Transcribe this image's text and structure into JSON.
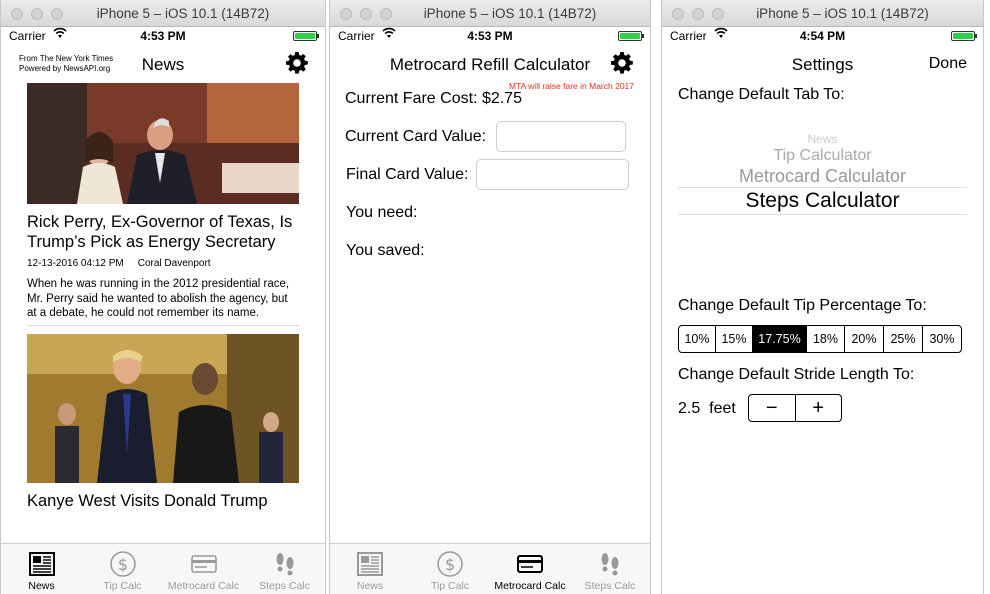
{
  "window_title": "iPhone 5 – iOS 10.1 (14B72)",
  "status": {
    "carrier": "Carrier",
    "times": [
      "4:53 PM",
      "4:53 PM",
      "4:54 PM"
    ]
  },
  "tabs": [
    "News",
    "Tip Calc",
    "Metrocard Calc",
    "Steps Calc"
  ],
  "news": {
    "title": "News",
    "credit_line1": "From The New York Times",
    "credit_line2": "Powered by NewsAPI.org",
    "articles": [
      {
        "headline": "Rick Perry, Ex-Governor of Texas, Is Trump’s Pick as Energy Secretary",
        "date": "12-13-2016 04:12 PM",
        "author": "Coral Davenport",
        "summary": "When he was running in the 2012 presidential race, Mr. Perry said he wanted to abolish the agency, but at a debate, he could not remember its name."
      },
      {
        "headline": "Kanye West Visits Donald Trump"
      }
    ]
  },
  "metrocard": {
    "title": "Metrocard Refill Calculator",
    "note": "MTA will raise fare in March 2017",
    "fare_label": "Current Fare Cost:",
    "fare_value": "$2.75",
    "card_value_label": "Current Card Value:",
    "final_value_label": "Final Card Value:",
    "need_label": "You need:",
    "saved_label": "You saved:"
  },
  "settings": {
    "title": "Settings",
    "done": "Done",
    "default_tab_label": "Change Default Tab To:",
    "picker_options": [
      "News",
      "Tip Calculator",
      "Metrocard Calculator",
      "Steps Calculator"
    ],
    "tip_label": "Change Default Tip Percentage To:",
    "tip_options": [
      "10%",
      "15%",
      "17.75%",
      "18%",
      "20%",
      "25%",
      "30%"
    ],
    "tip_selected": "17.75%",
    "stride_label": "Change Default Stride Length To:",
    "stride_value": "2.5",
    "stride_unit": "feet",
    "minus": "−",
    "plus": "+"
  },
  "colors": {
    "accent": "#000000",
    "note_red": "#e0301e",
    "battery": "#2fd14b"
  }
}
